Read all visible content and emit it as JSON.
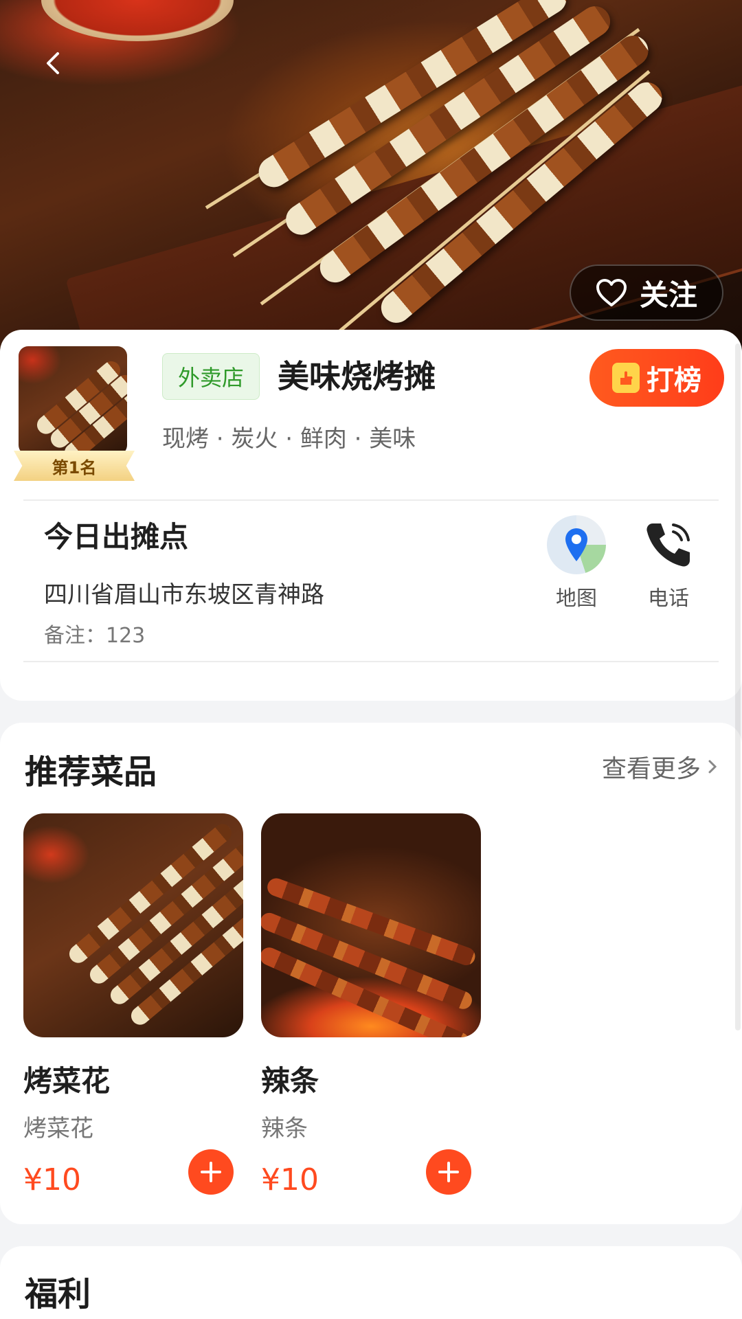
{
  "hero": {
    "follow_label": "关注"
  },
  "store": {
    "rank_label": "第1名",
    "type_tag": "外卖店",
    "name": "美味烧烤摊",
    "rank_button_label": "打榜",
    "tags": "现烤 · 炭火 · 鲜肉 · 美味"
  },
  "location": {
    "title": "今日出摊点",
    "address": "四川省眉山市东坡区青神路",
    "note": "备注：123",
    "map_label": "地图",
    "phone_label": "电话"
  },
  "recommend": {
    "title": "推荐菜品",
    "see_more": "查看更多",
    "dishes": [
      {
        "name": "烤菜花",
        "desc": "烤菜花",
        "price": "¥10"
      },
      {
        "name": "辣条",
        "desc": "辣条",
        "price": "¥10"
      }
    ]
  },
  "benefits": {
    "title": "福利"
  },
  "colors": {
    "accent": "#ff4a1f",
    "takeout_green": "#2f9a2a",
    "background": "#f3f4f6"
  },
  "icons": [
    "back-icon",
    "heart-icon",
    "medal-icon",
    "map-pin-icon",
    "phone-icon",
    "chevron-right-icon",
    "plus-icon"
  ]
}
